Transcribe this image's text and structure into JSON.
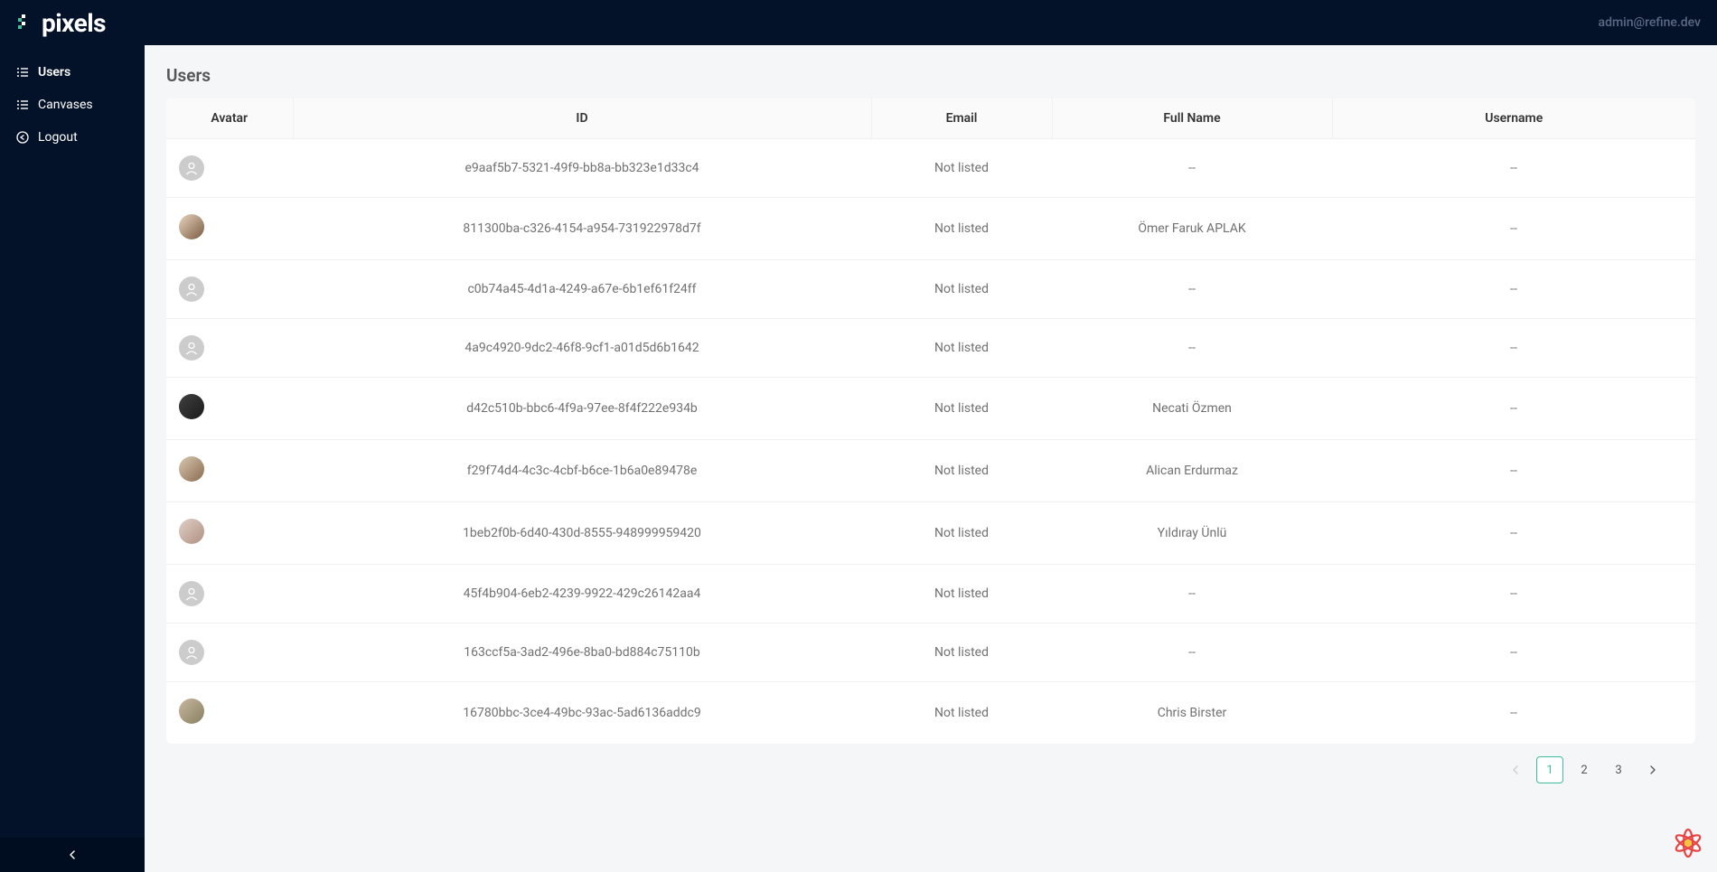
{
  "header": {
    "logo_text": "pixels",
    "user_email": "admin@refine.dev"
  },
  "sidebar": {
    "items": [
      {
        "label": "Users",
        "icon": "list",
        "selected": true
      },
      {
        "label": "Canvases",
        "icon": "list",
        "selected": false
      },
      {
        "label": "Logout",
        "icon": "logout",
        "selected": false
      }
    ]
  },
  "page": {
    "title": "Users"
  },
  "table": {
    "columns": [
      "Avatar",
      "ID",
      "Email",
      "Full Name",
      "Username"
    ],
    "rows": [
      {
        "avatar": "default",
        "id": "e9aaf5b7-5321-49f9-bb8a-bb323e1d33c4",
        "email": "Not listed",
        "full_name": "--",
        "username": "--"
      },
      {
        "avatar": "photo1",
        "id": "811300ba-c326-4154-a954-731922978d7f",
        "email": "Not listed",
        "full_name": "Ömer Faruk APLAK",
        "username": "--"
      },
      {
        "avatar": "default",
        "id": "c0b74a45-4d1a-4249-a67e-6b1ef61f24ff",
        "email": "Not listed",
        "full_name": "--",
        "username": "--"
      },
      {
        "avatar": "default",
        "id": "4a9c4920-9dc2-46f8-9cf1-a01d5d6b1642",
        "email": "Not listed",
        "full_name": "--",
        "username": "--"
      },
      {
        "avatar": "photo2",
        "id": "d42c510b-bbc6-4f9a-97ee-8f4f222e934b",
        "email": "Not listed",
        "full_name": "Necati Özmen",
        "username": "--"
      },
      {
        "avatar": "photo3",
        "id": "f29f74d4-4c3c-4cbf-b6ce-1b6a0e89478e",
        "email": "Not listed",
        "full_name": "Alican Erdurmaz",
        "username": "--"
      },
      {
        "avatar": "photo4",
        "id": "1beb2f0b-6d40-430d-8555-948999959420",
        "email": "Not listed",
        "full_name": "Yıldıray Ünlü",
        "username": "--"
      },
      {
        "avatar": "default",
        "id": "45f4b904-6eb2-4239-9922-429c26142aa4",
        "email": "Not listed",
        "full_name": "--",
        "username": "--"
      },
      {
        "avatar": "default",
        "id": "163ccf5a-3ad2-496e-8ba0-bd884c75110b",
        "email": "Not listed",
        "full_name": "--",
        "username": "--"
      },
      {
        "avatar": "photo5",
        "id": "16780bbc-3ce4-49bc-93ac-5ad6136addc9",
        "email": "Not listed",
        "full_name": "Chris Birster",
        "username": "--"
      }
    ]
  },
  "pagination": {
    "pages": [
      "1",
      "2",
      "3"
    ],
    "current": "1"
  }
}
